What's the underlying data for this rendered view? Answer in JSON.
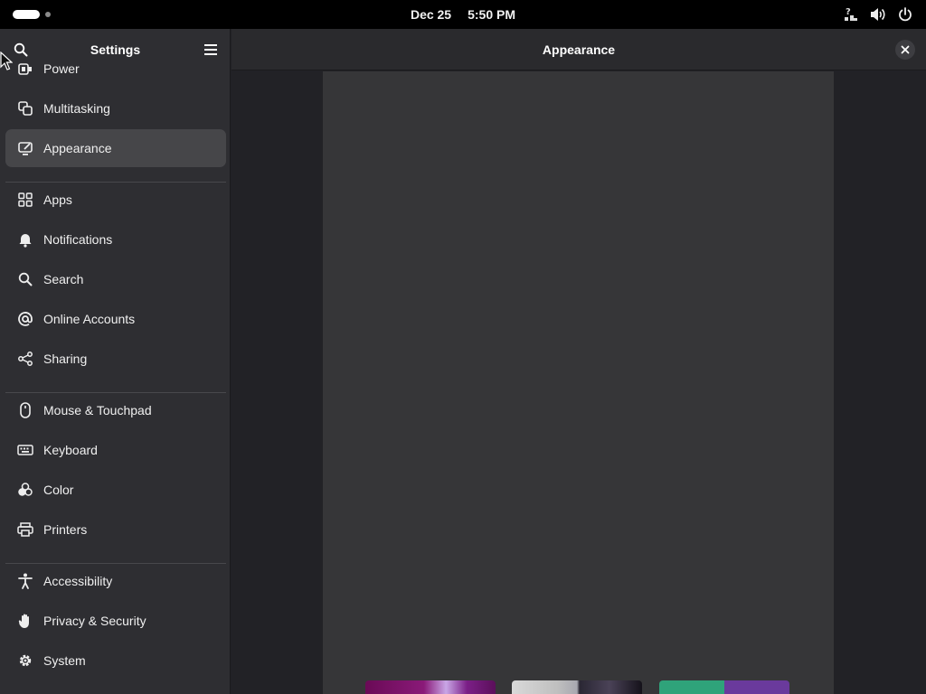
{
  "topbar": {
    "date": "Dec 25",
    "time": "5:50 PM",
    "tray_icons": [
      "accessibility-network-icon",
      "volume-icon",
      "power-icon"
    ]
  },
  "sidebar": {
    "title": "Settings",
    "items": [
      {
        "label": "Power",
        "icon": "power-plug-icon"
      },
      {
        "label": "Multitasking",
        "icon": "multitasking-icon"
      },
      {
        "label": "Appearance",
        "icon": "appearance-icon",
        "selected": true
      },
      {
        "label": "Apps",
        "icon": "apps-grid-icon"
      },
      {
        "label": "Notifications",
        "icon": "bell-icon"
      },
      {
        "label": "Search",
        "icon": "search-icon"
      },
      {
        "label": "Online Accounts",
        "icon": "at-sign-icon"
      },
      {
        "label": "Sharing",
        "icon": "share-icon"
      },
      {
        "label": "Mouse & Touchpad",
        "icon": "mouse-icon"
      },
      {
        "label": "Keyboard",
        "icon": "keyboard-icon"
      },
      {
        "label": "Color",
        "icon": "color-icon"
      },
      {
        "label": "Printers",
        "icon": "printer-icon"
      },
      {
        "label": "Accessibility",
        "icon": "accessibility-icon"
      },
      {
        "label": "Privacy & Security",
        "icon": "hand-icon"
      },
      {
        "label": "System",
        "icon": "gear-icon"
      }
    ]
  },
  "content": {
    "title": "Appearance"
  },
  "colors": {
    "sidebar_bg": "#2e2e32",
    "selected_row": "#464649",
    "content_bg": "#222226",
    "preview_bg": "#363638"
  }
}
